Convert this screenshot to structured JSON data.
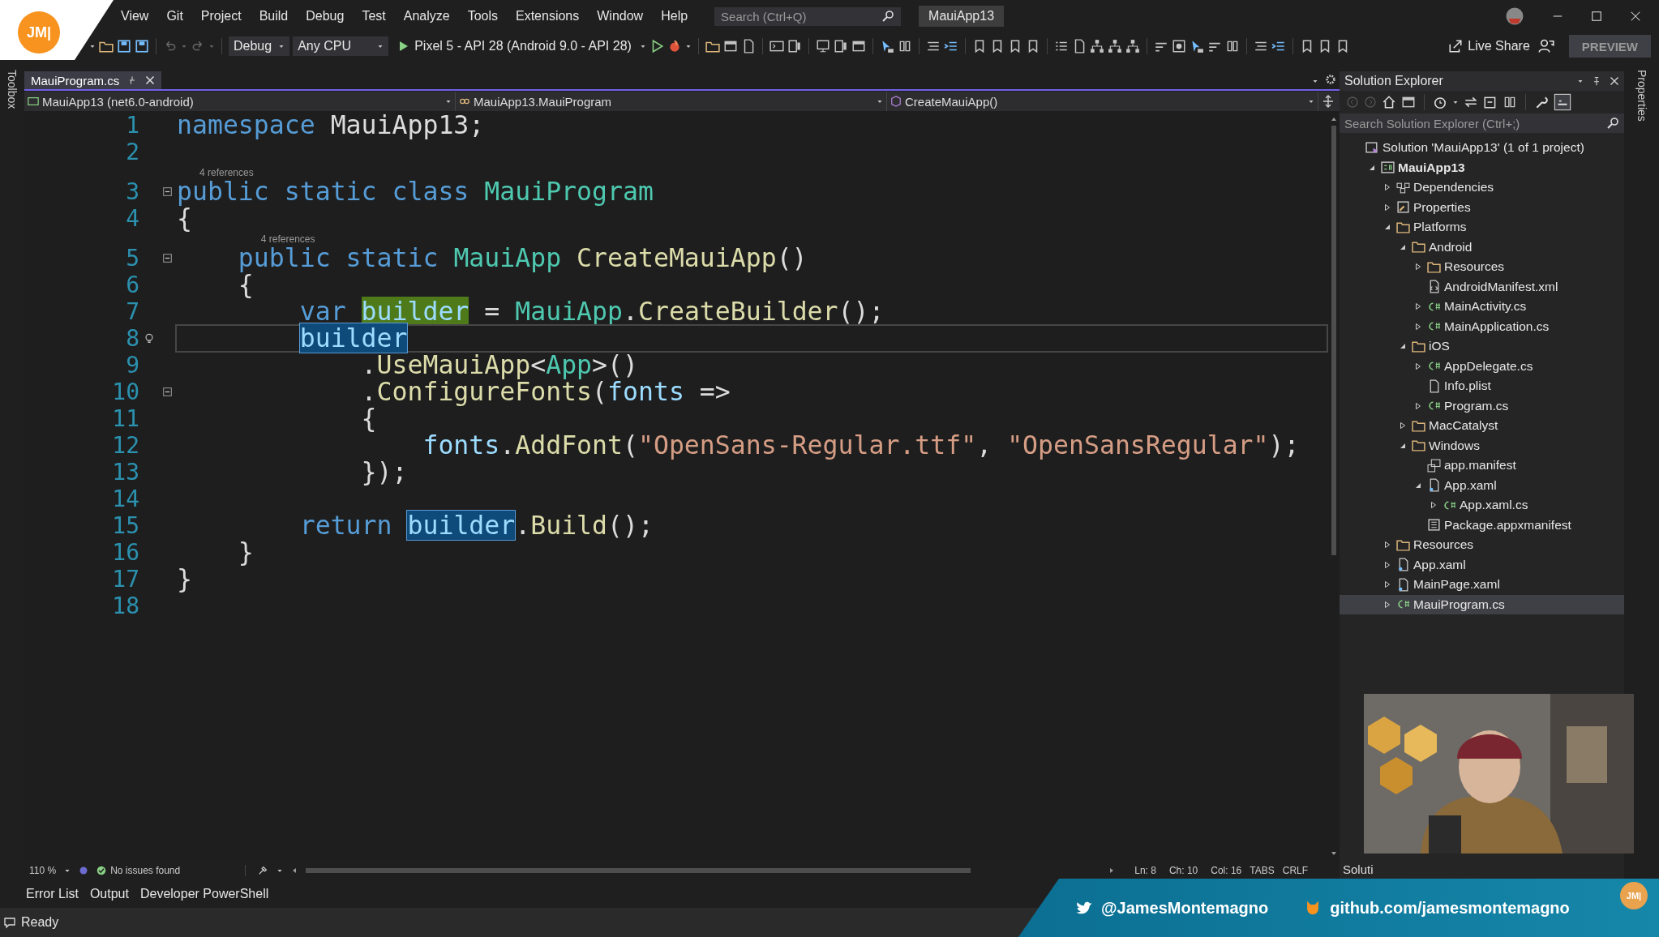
{
  "logo": {
    "text": "JM|"
  },
  "menu": [
    {
      "label": "View"
    },
    {
      "label": "Git"
    },
    {
      "label": "Project"
    },
    {
      "label": "Build"
    },
    {
      "label": "Debug"
    },
    {
      "label": "Test"
    },
    {
      "label": "Analyze"
    },
    {
      "label": "Tools"
    },
    {
      "label": "Extensions"
    },
    {
      "label": "Window"
    },
    {
      "label": "Help"
    }
  ],
  "search": {
    "placeholder": "Search (Ctrl+Q)"
  },
  "window": {
    "title": "MauiApp13"
  },
  "toolbar": {
    "configuration": "Debug",
    "platform": "Any CPU",
    "target": "Pixel 5 - API 28 (Android 9.0 - API 28)",
    "live_share": "Live Share",
    "preview": "PREVIEW"
  },
  "left_strip": {
    "label": "Toolbox"
  },
  "right_strip": {
    "label": "Properties"
  },
  "tabs": [
    {
      "label": "MauiProgram.cs",
      "selected": true
    }
  ],
  "nav_bar": {
    "project": "MauiApp13 (net6.0-android)",
    "type": "MauiApp13.MauiProgram",
    "member": "CreateMauiApp()"
  },
  "code": {
    "lines": [
      {
        "number": "1",
        "current": false,
        "fold": false,
        "lightbulb": false,
        "tokens": [
          {
            "kind": "keyword",
            "text": "namespace"
          },
          {
            "kind": "plain",
            "text": " MauiApp13;"
          }
        ]
      },
      {
        "number": "2",
        "current": false,
        "fold": false,
        "lightbulb": false
      },
      {
        "number": "3",
        "current": false,
        "fold": true,
        "lightbulb": false,
        "lens": "4 references",
        "tokens": [
          {
            "kind": "keyword",
            "text": "public static class "
          },
          {
            "kind": "type",
            "text": "MauiProgram"
          }
        ]
      },
      {
        "number": "4",
        "current": false,
        "fold": false,
        "lightbulb": false,
        "tokens": [
          {
            "kind": "plain",
            "text": "{"
          }
        ]
      },
      {
        "number": "5",
        "current": false,
        "fold": true,
        "lightbulb": false,
        "lens": "4 references",
        "tokens": [
          {
            "kind": "keyword",
            "text": "    public static "
          },
          {
            "kind": "type",
            "text": "MauiApp "
          },
          {
            "kind": "method",
            "text": "CreateMauiApp"
          },
          {
            "kind": "plain",
            "text": "()"
          }
        ]
      },
      {
        "number": "6",
        "current": false,
        "fold": false,
        "lightbulb": false,
        "tokens": [
          {
            "kind": "plain",
            "text": "    {"
          }
        ]
      },
      {
        "number": "7",
        "current": false,
        "fold": false,
        "lightbulb": false,
        "tokens": [
          {
            "kind": "keyword",
            "text": "        var "
          },
          {
            "kind": "definition",
            "text": "builder"
          },
          {
            "kind": "plain",
            "text": " = "
          },
          {
            "kind": "type",
            "text": "MauiApp"
          },
          {
            "kind": "plain",
            "text": "."
          },
          {
            "kind": "method",
            "text": "CreateBuilder"
          },
          {
            "kind": "plain",
            "text": "();"
          }
        ]
      },
      {
        "number": "8",
        "current": true,
        "fold": false,
        "lightbulb": true,
        "tokens": [
          {
            "kind": "reference",
            "text": "        builder"
          }
        ]
      },
      {
        "number": "9",
        "current": false,
        "fold": false,
        "lightbulb": false,
        "tokens": [
          {
            "kind": "plain",
            "text": "            ."
          },
          {
            "kind": "method",
            "text": "UseMauiApp"
          },
          {
            "kind": "plain",
            "text": "<"
          },
          {
            "kind": "type",
            "text": "App"
          },
          {
            "kind": "plain",
            "text": ">()"
          }
        ]
      },
      {
        "number": "10",
        "current": false,
        "fold": true,
        "lightbulb": false,
        "tokens": [
          {
            "kind": "plain",
            "text": "            ."
          },
          {
            "kind": "method",
            "text": "ConfigureFonts"
          },
          {
            "kind": "plain",
            "text": "("
          },
          {
            "kind": "variable",
            "text": "fonts"
          },
          {
            "kind": "plain",
            "text": " =>"
          }
        ]
      },
      {
        "number": "11",
        "current": false,
        "fold": false,
        "lightbulb": false,
        "tokens": [
          {
            "kind": "plain",
            "text": "            {"
          }
        ]
      },
      {
        "number": "12",
        "current": false,
        "fold": false,
        "lightbulb": false,
        "tokens": [
          {
            "kind": "variable",
            "text": "                fonts"
          },
          {
            "kind": "plain",
            "text": "."
          },
          {
            "kind": "method",
            "text": "AddFont"
          },
          {
            "kind": "plain",
            "text": "("
          },
          {
            "kind": "string",
            "text": "\"OpenSans-Regular.ttf\""
          },
          {
            "kind": "plain",
            "text": ", "
          },
          {
            "kind": "string",
            "text": "\"OpenSansRegular\""
          },
          {
            "kind": "plain",
            "text": ");"
          }
        ]
      },
      {
        "number": "13",
        "current": false,
        "fold": false,
        "lightbulb": false,
        "tokens": [
          {
            "kind": "plain",
            "text": "            });"
          }
        ]
      },
      {
        "number": "14",
        "current": false,
        "fold": false,
        "lightbulb": false
      },
      {
        "number": "15",
        "current": false,
        "fold": false,
        "lightbulb": false,
        "tokens": [
          {
            "kind": "keyword",
            "text": "        return "
          },
          {
            "kind": "reference",
            "text": "builder"
          },
          {
            "kind": "plain",
            "text": "."
          },
          {
            "kind": "method",
            "text": "Build"
          },
          {
            "kind": "plain",
            "text": "();"
          }
        ]
      },
      {
        "number": "16",
        "current": false,
        "fold": false,
        "lightbulb": false,
        "tokens": [
          {
            "kind": "plain",
            "text": "    }"
          }
        ]
      },
      {
        "number": "17",
        "current": false,
        "fold": false,
        "lightbulb": false,
        "tokens": [
          {
            "kind": "plain",
            "text": "}"
          }
        ]
      },
      {
        "number": "18",
        "current": false,
        "fold": false,
        "lightbulb": false
      }
    ]
  },
  "editor_status": {
    "zoom": "110 %",
    "issues": "No issues found",
    "line": "Ln: 8",
    "char": "Ch: 10",
    "column": "Col: 16",
    "indent": "TABS",
    "line_ending": "CRLF"
  },
  "solution_explorer": {
    "title": "Solution Explorer",
    "search": {
      "placeholder": "Search Solution Explorer (Ctrl+;)"
    },
    "tree": [
      {
        "label": "Solution 'MauiApp13' (1 of 1 project)",
        "kind": "solution",
        "selected": false,
        "children": [
          {
            "label": "MauiApp13",
            "kind": "project",
            "expanded": true,
            "selected": false,
            "children": [
              {
                "label": "Dependencies",
                "kind": "dependencies",
                "expanded": false,
                "selected": false
              },
              {
                "label": "Properties",
                "kind": "properties",
                "expanded": false,
                "selected": false
              },
              {
                "label": "Platforms",
                "kind": "folder",
                "expanded": true,
                "selected": false,
                "children": [
                  {
                    "label": "Android",
                    "kind": "folder",
                    "expanded": true,
                    "selected": false,
                    "children": [
                      {
                        "label": "Resources",
                        "kind": "folder",
                        "expanded": false,
                        "selected": false
                      },
                      {
                        "label": "AndroidManifest.xml",
                        "kind": "xml",
                        "selected": false
                      },
                      {
                        "label": "MainActivity.cs",
                        "kind": "csharp",
                        "expanded": false,
                        "selected": false
                      },
                      {
                        "label": "MainApplication.cs",
                        "kind": "csharp",
                        "expanded": false,
                        "selected": false
                      }
                    ]
                  },
                  {
                    "label": "iOS",
                    "kind": "folder",
                    "expanded": true,
                    "selected": false,
                    "children": [
                      {
                        "label": "AppDelegate.cs",
                        "kind": "csharp",
                        "expanded": false,
                        "selected": false
                      },
                      {
                        "label": "Info.plist",
                        "kind": "file",
                        "selected": false
                      },
                      {
                        "label": "Program.cs",
                        "kind": "csharp",
                        "expanded": false,
                        "selected": false
                      }
                    ]
                  },
                  {
                    "label": "MacCatalyst",
                    "kind": "folder",
                    "expanded": false,
                    "selected": false
                  },
                  {
                    "label": "Windows",
                    "kind": "folder",
                    "expanded": true,
                    "selected": false,
                    "children": [
                      {
                        "label": "app.manifest",
                        "kind": "manifest",
                        "selected": false
                      },
                      {
                        "label": "App.xaml",
                        "kind": "xaml",
                        "expanded": true,
                        "selected": false,
                        "children": [
                          {
                            "label": "App.xaml.cs",
                            "kind": "csharp",
                            "expanded": false,
                            "selected": false
                          }
                        ]
                      },
                      {
                        "label": "Package.appxmanifest",
                        "kind": "package",
                        "selected": false
                      }
                    ]
                  }
                ]
              },
              {
                "label": "Resources",
                "kind": "folder",
                "expanded": false,
                "selected": false
              },
              {
                "label": "App.xaml",
                "kind": "xaml",
                "expanded": false,
                "selected": false
              },
              {
                "label": "MainPage.xaml",
                "kind": "xaml",
                "expanded": false,
                "selected": false
              },
              {
                "label": "MauiProgram.cs",
                "kind": "csharp",
                "expanded": false,
                "selected": true
              }
            ]
          }
        ]
      }
    ]
  },
  "side_tab": {
    "label": "Soluti"
  },
  "bottom_tabs": [
    {
      "label": "Error List"
    },
    {
      "label": "Output"
    },
    {
      "label": "Developer PowerShell"
    }
  ],
  "status_bar": {
    "text": "Ready"
  },
  "banner": {
    "twitter": "@JamesMontemagno",
    "github": "github.com/jamesmontemagno",
    "logo": "JM|"
  }
}
